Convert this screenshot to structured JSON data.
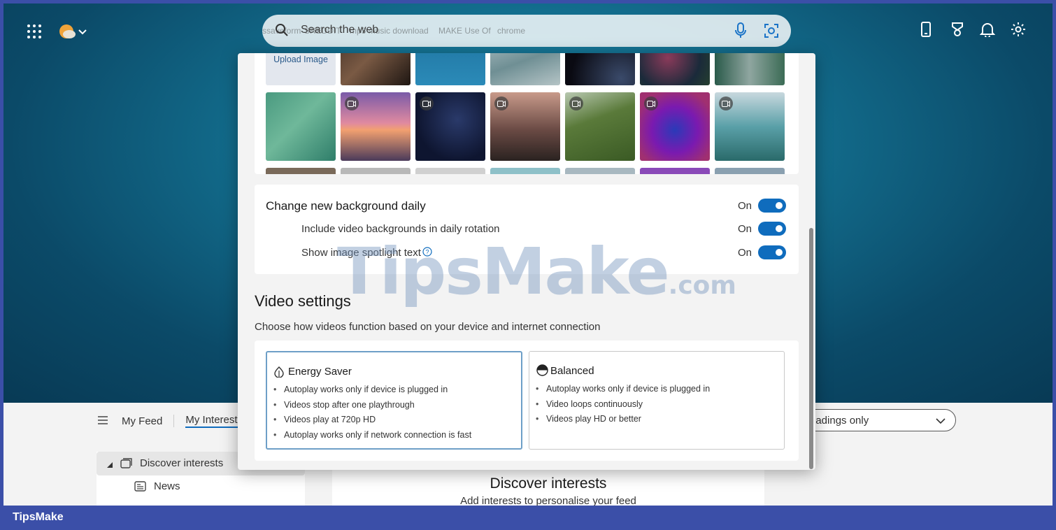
{
  "browser": {
    "search_placeholder": "Search the web",
    "search_ghost": [
      "ssaveform",
      "SREDDIT",
      "mp3 music download",
      "MAKE Use Of",
      "chrome"
    ]
  },
  "gallery": {
    "upload_label": "Upload Image"
  },
  "daily": {
    "title": "Change new background daily",
    "title_state": "On",
    "video_label": "Include video backgrounds in daily rotation",
    "video_state": "On",
    "spotlight_label": "Show image spotlight text",
    "spotlight_state": "On"
  },
  "video_settings": {
    "heading": "Video settings",
    "subtitle": "Choose how videos function based on your device and internet connection",
    "options": [
      {
        "title": "Energy Saver",
        "selected": true,
        "bullets": [
          "Autoplay works only if device is plugged in",
          "Videos stop after one playthrough",
          "Videos play at 720p HD",
          "Autoplay works only if network connection is fast"
        ]
      },
      {
        "title": "Balanced",
        "selected": false,
        "bullets": [
          "Autoplay works only if device is plugged in",
          "Video loops continuously",
          "Videos play HD or better"
        ]
      }
    ]
  },
  "feed": {
    "tabs": [
      "My Feed",
      "My Interests"
    ],
    "dropdown": "eadings only",
    "sidebar": [
      "Discover interests",
      "News"
    ],
    "card_title": "Discover interests",
    "card_sub": "Add interests to personalise your feed"
  },
  "watermark": {
    "main": "TipsMake",
    "suffix": ".com"
  },
  "footer": {
    "brand": "TipsMake"
  },
  "colors": {
    "accent": "#0f6cbd",
    "footer": "#3b4fa8"
  }
}
